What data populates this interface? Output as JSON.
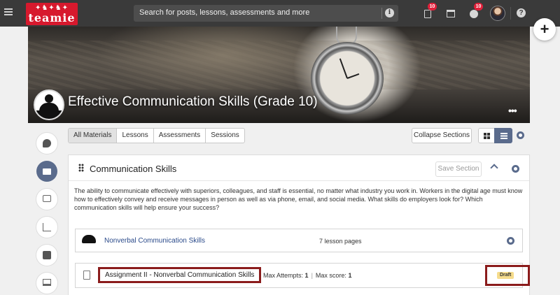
{
  "topbar": {
    "logo_text": "teamie",
    "search_placeholder": "Search for posts, lessons, assessments and more",
    "notifications_count": "10",
    "globe_count": "10",
    "help_label": "?"
  },
  "course": {
    "title": "Effective Communication Skills (Grade 10)",
    "more": "•••"
  },
  "toolbar": {
    "tabs": [
      "All Materials",
      "Lessons",
      "Assessments",
      "Sessions"
    ],
    "active_tab": "All Materials",
    "collapse_label": "Collapse Sections"
  },
  "section": {
    "title": "Communication Skills",
    "save_label": "Save Section",
    "description": "The ability to communicate effectively with superiors, colleagues, and staff is essential, no matter what industry you work in. Workers in the digital age must know how to effectively convey and receive messages in person as well as via phone, email, and social media. What skills do employers look for? Which communication skills will help ensure your success?",
    "lesson": {
      "title": "Nonverbal Communication Skills",
      "pages": "7 lesson pages"
    },
    "assignment": {
      "title": "Assignment II - Nonverbal Communication Skills",
      "attempts_label": "Max Attempts:",
      "attempts_value": "1",
      "score_label": "Max score:",
      "score_value": "1",
      "status": "Draft"
    }
  },
  "colors": {
    "topbar": "#3a3a3a",
    "brand_red": "#d7192d",
    "accent": "#5a6b8c",
    "highlight": "#8b1c1c",
    "draft_badge": "#f6dc8c"
  }
}
